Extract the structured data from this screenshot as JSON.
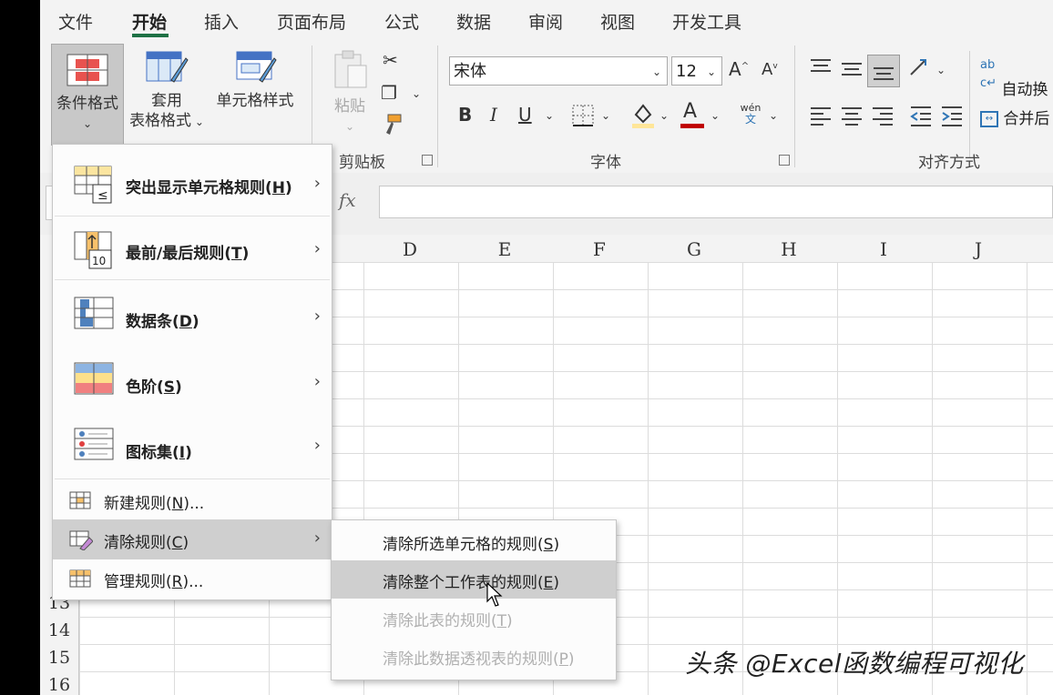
{
  "menubar": {
    "tabs": [
      "文件",
      "开始",
      "插入",
      "页面布局",
      "公式",
      "数据",
      "审阅",
      "视图",
      "开发工具"
    ],
    "active_tab": "开始"
  },
  "ribbon": {
    "styles": {
      "conditional_format": "条件格式",
      "table_format_line1": "套用",
      "table_format_line2": "表格格式",
      "cell_styles": "单元格样式"
    },
    "clipboard": {
      "paste": "粘贴",
      "group_label": "剪贴板"
    },
    "font": {
      "font_name": "宋体",
      "font_size": "12",
      "bold": "B",
      "italic": "I",
      "underline": "U",
      "phonetic_top": "wén",
      "phonetic_bottom": "文",
      "group_label": "字体"
    },
    "alignment": {
      "wrap_text": "自动换",
      "merge": "合并后",
      "group_label": "对齐方式"
    }
  },
  "formula_bar": {
    "fx": "fx"
  },
  "grid": {
    "columns": [
      "D",
      "E",
      "F",
      "G",
      "H",
      "I",
      "J"
    ],
    "rows": [
      "13",
      "14",
      "15",
      "16"
    ]
  },
  "menu": {
    "items": [
      {
        "label": "突出显示单元格规则",
        "key": "H"
      },
      {
        "label": "最前/最后规则",
        "key": "T"
      },
      {
        "label": "数据条",
        "key": "D"
      },
      {
        "label": "色阶",
        "key": "S"
      },
      {
        "label": "图标集",
        "key": "I"
      }
    ],
    "small_items": [
      {
        "label": "新建规则",
        "key": "N",
        "suffix": "..."
      },
      {
        "label": "清除规则",
        "key": "C",
        "suffix": ""
      },
      {
        "label": "管理规则",
        "key": "R",
        "suffix": "..."
      }
    ]
  },
  "submenu": {
    "items": [
      {
        "label": "清除所选单元格的规则",
        "key": "S",
        "disabled": false
      },
      {
        "label": "清除整个工作表的规则",
        "key": "E",
        "disabled": false
      },
      {
        "label": "清除此表的规则",
        "key": "T",
        "disabled": true
      },
      {
        "label": "清除此数据透视表的规则",
        "key": "P",
        "disabled": true
      }
    ]
  },
  "watermark": "头条 @Excel函数编程可视化",
  "colors": {
    "accent_green": "#1e7145",
    "highlight": "#cfcfcf",
    "disabled_text": "#b0b0b0"
  }
}
